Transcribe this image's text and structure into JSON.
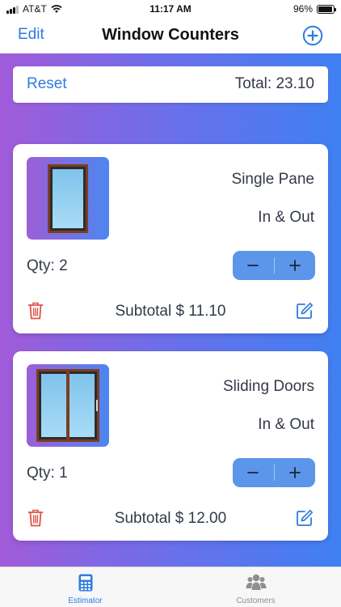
{
  "status_bar": {
    "carrier": "AT&T",
    "time": "11:17 AM",
    "battery": "96%",
    "battery_level": 0.96
  },
  "nav": {
    "edit_label": "Edit",
    "title": "Window Counters",
    "add_icon": "plus-circle-icon"
  },
  "summary": {
    "reset_label": "Reset",
    "total_label": "Total: 23.10"
  },
  "items": [
    {
      "name": "Single Pane",
      "side": "In & Out",
      "qty_label": "Qty: 2",
      "subtotal_label": "Subtotal $  11.10",
      "minus": "−",
      "plus": "+"
    },
    {
      "name": "Sliding Doors",
      "side": "In & Out",
      "qty_label": "Qty: 1",
      "subtotal_label": "Subtotal $  12.00",
      "minus": "−",
      "plus": "+"
    }
  ],
  "tabs": [
    {
      "label": "Estimator",
      "icon": "calculator-icon",
      "selected": true
    },
    {
      "label": "Customers",
      "icon": "people-icon",
      "selected": false
    }
  ],
  "colors": {
    "accent": "#2f7be0",
    "stepper": "#5b96ea",
    "danger": "#e0524a",
    "gradient_start": "#a15bd9",
    "gradient_end": "#3f80f2"
  }
}
